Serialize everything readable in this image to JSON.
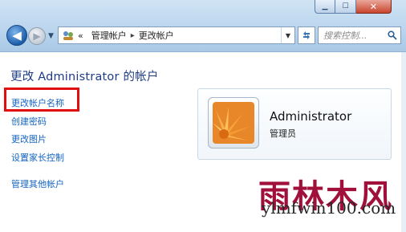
{
  "breadcrumb": {
    "overflow": "«",
    "items": [
      "管理帐户",
      "更改帐户"
    ],
    "separator": "▸"
  },
  "search": {
    "placeholder": "搜索控制..."
  },
  "heading": "更改 Administrator 的帐户",
  "links": {
    "change_name": "更改帐户名称",
    "create_password": "创建密码",
    "change_picture": "更改图片",
    "parental_controls": "设置家长控制",
    "manage_other": "管理其他帐户"
  },
  "user": {
    "name": "Administrator",
    "role": "管理员"
  },
  "watermark": {
    "cn": "雨林木风",
    "url": "ylmfwin100.com"
  },
  "colors": {
    "link": "#1565c0",
    "heading": "#1e3b87",
    "highlight": "#e01010",
    "watermark": "#a0103a"
  },
  "icons": [
    "back-arrow-icon",
    "forward-arrow-icon",
    "control-panel-icon",
    "refresh-icon",
    "search-icon",
    "minimize-icon",
    "maximize-icon",
    "close-icon",
    "flower-icon"
  ]
}
